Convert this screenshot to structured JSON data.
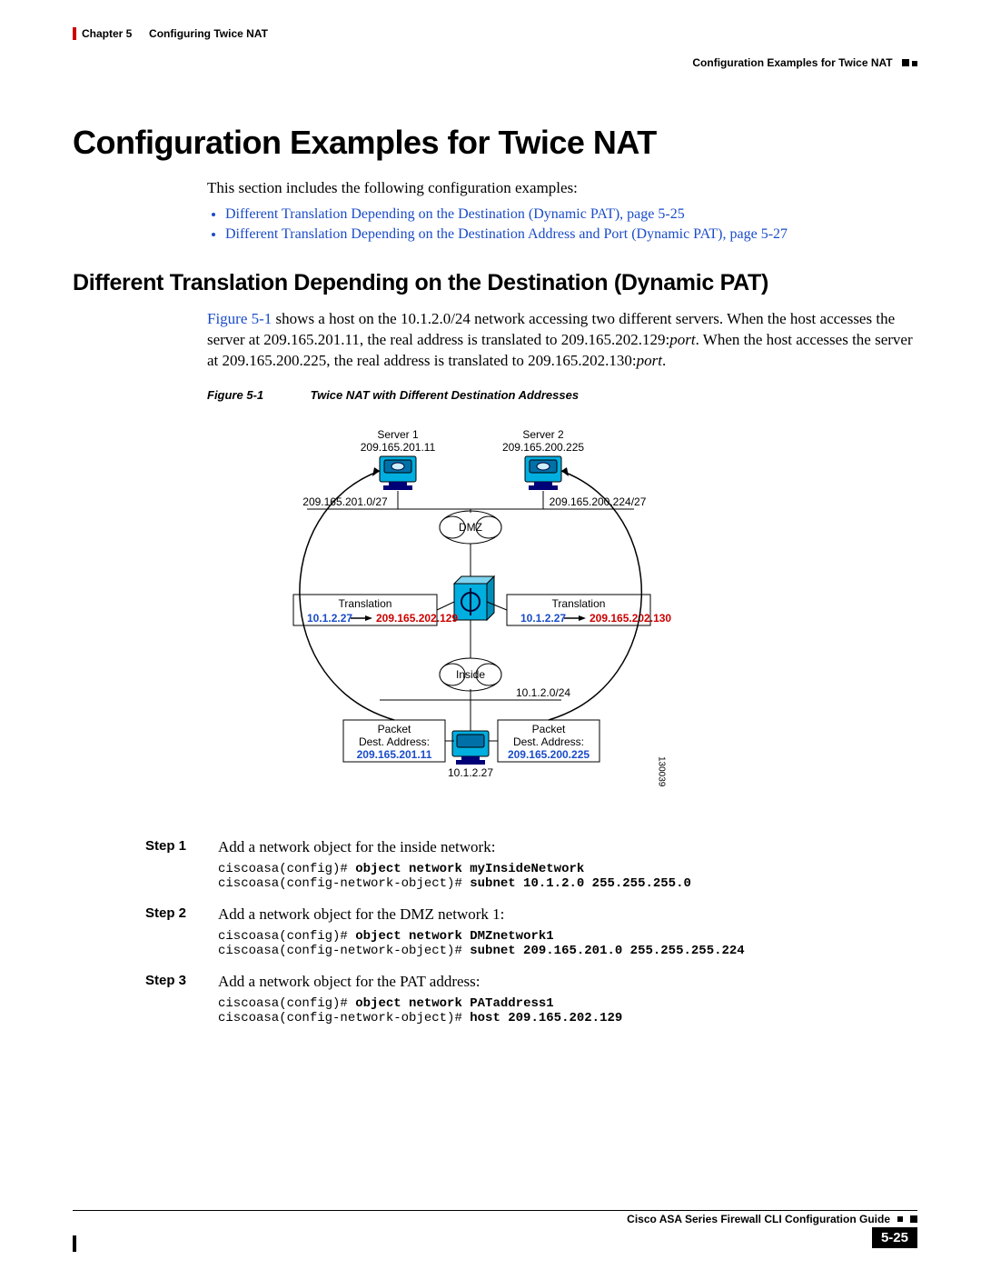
{
  "header": {
    "chapter_label": "Chapter 5",
    "chapter_title": "Configuring Twice NAT",
    "section_title": "Configuration Examples for Twice NAT"
  },
  "h1": "Configuration Examples for Twice NAT",
  "intro": "This section includes the following configuration examples:",
  "links": [
    "Different Translation Depending on the Destination (Dynamic PAT), page 5-25",
    "Different Translation Depending on the Destination Address and Port (Dynamic PAT), page 5-27"
  ],
  "h2": "Different Translation Depending on the Destination (Dynamic PAT)",
  "para_prefix": "Figure 5-1",
  "para_rest_1": " shows a host on the 10.1.2.0/24 network accessing two different servers. When the host accesses the server at 209.165.201.11, the real address is translated to 209.165.202.129:",
  "para_port1": "port",
  "para_rest_2": ". When the host accesses the server at 209.165.200.225, the real address is translated to 209.165.202.130:",
  "para_port2": "port",
  "para_end": ".",
  "figure": {
    "label": "Figure 5-1",
    "title": "Twice NAT with Different Destination Addresses",
    "server1_name": "Server 1",
    "server1_ip": "209.165.201.11",
    "server2_name": "Server 2",
    "server2_ip": "209.165.200.225",
    "net_left": "209.165.201.0/27",
    "net_right": "209.165.200.224/27",
    "dmz": "DMZ",
    "translation": "Translation",
    "t1_src": "10.1.2.27",
    "t1_dst": "209.165.202.129",
    "t2_src": "10.1.2.27",
    "t2_dst": "209.165.202.130",
    "inside": "Inside",
    "inside_net": "10.1.2.0/24",
    "packet_label": "Packet",
    "dest_label": "Dest. Address:",
    "p1_dest": "209.165.201.11",
    "p2_dest": "209.165.200.225",
    "host_ip": "10.1.2.27",
    "image_id": "130039"
  },
  "steps": [
    {
      "label": "Step 1",
      "text": "Add a network object for the inside network:",
      "cli": [
        {
          "prompt": "ciscoasa(config)# ",
          "cmd": "object network myInsideNetwork"
        },
        {
          "prompt": "ciscoasa(config-network-object)# ",
          "cmd": "subnet 10.1.2.0 255.255.255.0"
        }
      ]
    },
    {
      "label": "Step 2",
      "text": "Add a network object for the DMZ network 1:",
      "cli": [
        {
          "prompt": "ciscoasa(config)# ",
          "cmd": "object network DMZnetwork1"
        },
        {
          "prompt": "ciscoasa(config-network-object)# ",
          "cmd": "subnet 209.165.201.0 255.255.255.224"
        }
      ]
    },
    {
      "label": "Step 3",
      "text": "Add a network object for the PAT address:",
      "cli": [
        {
          "prompt": "ciscoasa(config)# ",
          "cmd": "object network PATaddress1"
        },
        {
          "prompt": "ciscoasa(config-network-object)# ",
          "cmd": "host 209.165.202.129"
        }
      ]
    }
  ],
  "footer": {
    "book": "Cisco ASA Series Firewall CLI Configuration Guide",
    "page": "5-25"
  }
}
